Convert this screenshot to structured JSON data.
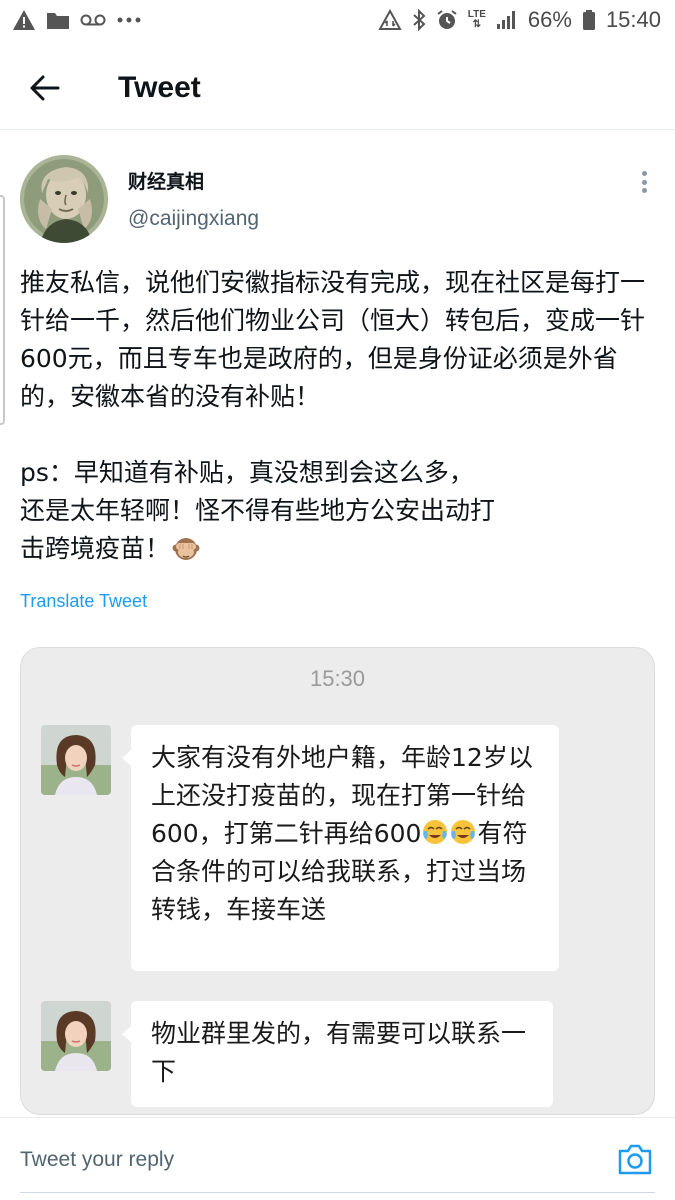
{
  "status_bar": {
    "signal_label": "LTE",
    "battery": "66%",
    "time": "15:40",
    "icons": [
      "warning-icon",
      "folder-icon",
      "voicemail-icon",
      "more-dots-icon",
      "data-sync-icon",
      "bluetooth-icon",
      "alarm-icon",
      "signal-icon",
      "battery-icon"
    ]
  },
  "header": {
    "title": "Tweet",
    "back_icon": "arrow-left-icon"
  },
  "tweet": {
    "author_name": "财经真相",
    "author_handle": "@caijingxiang",
    "text": "推友私信，说他们安徽指标没有完成，现在社区是每打一针给一千，然后他们物业公司（恒大）转包后，变成一针600元，而且专车也是政府的，但是身份证必须是外省的，安徽本省的没有补贴！\n\nps：早知道有补贴，真没想到会这么多，\n还是太年轻啊！怪不得有些地方公安出动打\n击跨境疫苗！",
    "trailing_emoji": "see-no-evil-monkey-icon",
    "translate_label": "Translate Tweet"
  },
  "chat_image": {
    "time": "15:30",
    "messages": [
      {
        "text_before_emoji": "大家有没有外地户籍，年龄12岁以上还没打疫苗的，现在打第一针给600，打第二针再给600",
        "emoji": "sob-laugh-icon",
        "text_after_emoji": "有符合条件的可以给我联系，打过当场转钱，车接车送"
      },
      {
        "text": "物业群里发的，有需要可以联系一下"
      }
    ]
  },
  "reply": {
    "placeholder": "Tweet your reply",
    "camera_icon": "camera-icon"
  },
  "colors": {
    "link_blue": "#1d9bf0",
    "secondary_text": "#536471",
    "chat_background": "#ececec"
  }
}
